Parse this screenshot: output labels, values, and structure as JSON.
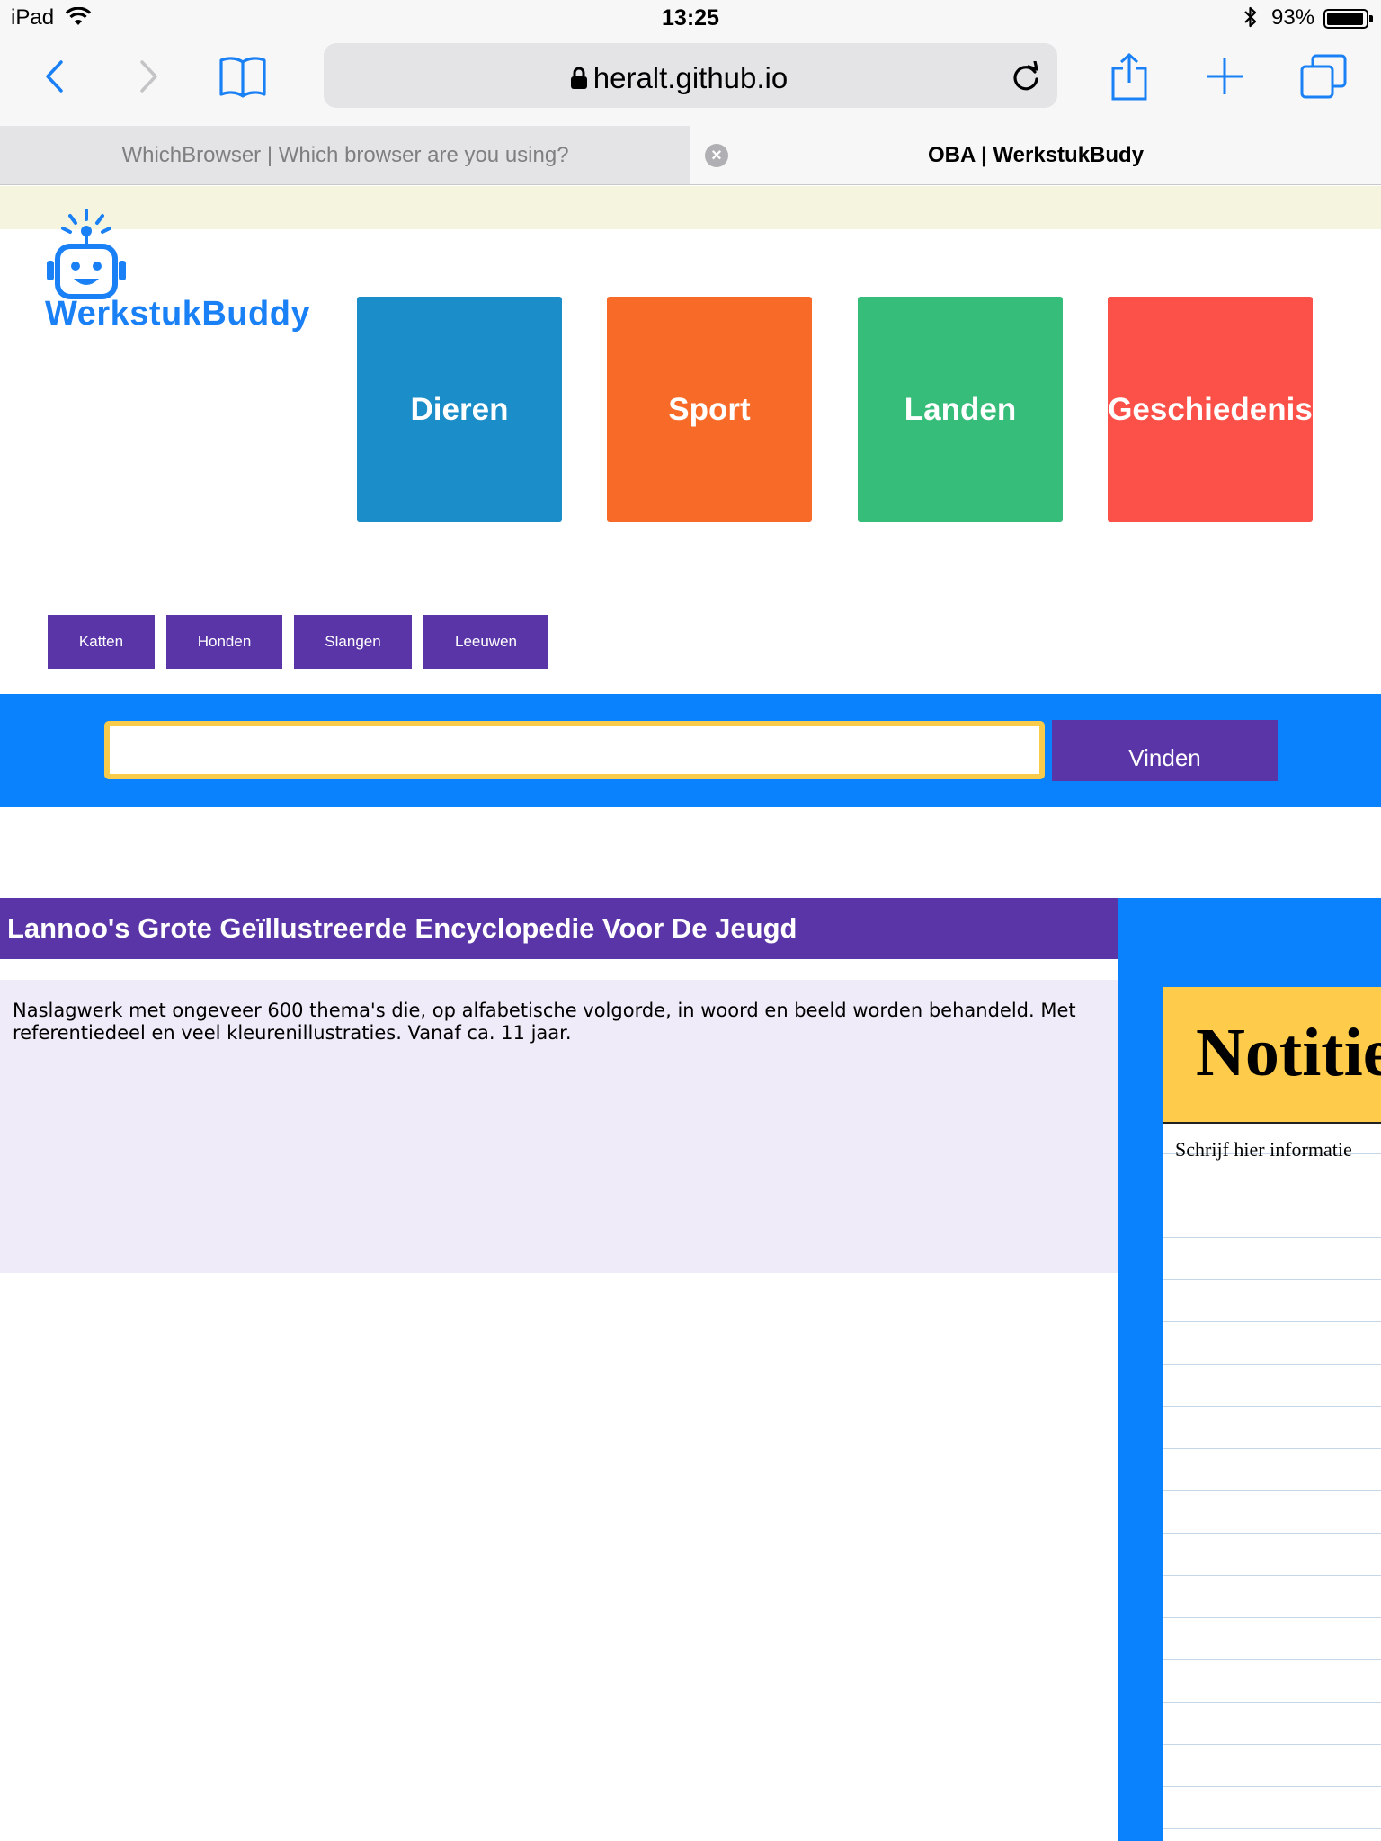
{
  "status_bar": {
    "device": "iPad",
    "time": "13:25",
    "battery": "93%"
  },
  "browser": {
    "url": "heralt.github.io",
    "tabs": [
      {
        "label": "WhichBrowser | Which browser are you using?",
        "active": false
      },
      {
        "label": "OBA | WerkstukBudy",
        "active": true
      }
    ]
  },
  "page": {
    "logo_text": "WerkstukBuddy",
    "categories": [
      {
        "label": "Dieren",
        "color": "#1b8dc8"
      },
      {
        "label": "Sport",
        "color": "#f86a28"
      },
      {
        "label": "Landen",
        "color": "#37bd7a"
      },
      {
        "label": "Geschiedenis",
        "color": "#fc5148"
      }
    ],
    "subcategories": [
      "Katten",
      "Honden",
      "Slangen",
      "Leeuwen"
    ],
    "search": {
      "value": "",
      "placeholder": "",
      "button_label": "Vinden"
    },
    "result": {
      "title": "Lannoo's Grote Geïllustreerde Encyclopedie Voor De Jeugd",
      "description": "Naslagwerk met ongeveer 600 thema's die, op alfabetische volgorde, in woord en beeld worden behandeld. Met referentiedeel en veel kleurenillustraties. Vanaf ca. 11 jaar."
    },
    "notes": {
      "title": "Notitie",
      "placeholder": "Schrijf hier informatie"
    }
  },
  "colors": {
    "brand_blue": "#0a81fd",
    "purple": "#5a35a8",
    "notes_yellow": "#fecb4a",
    "search_border": "#f8cb4a"
  }
}
